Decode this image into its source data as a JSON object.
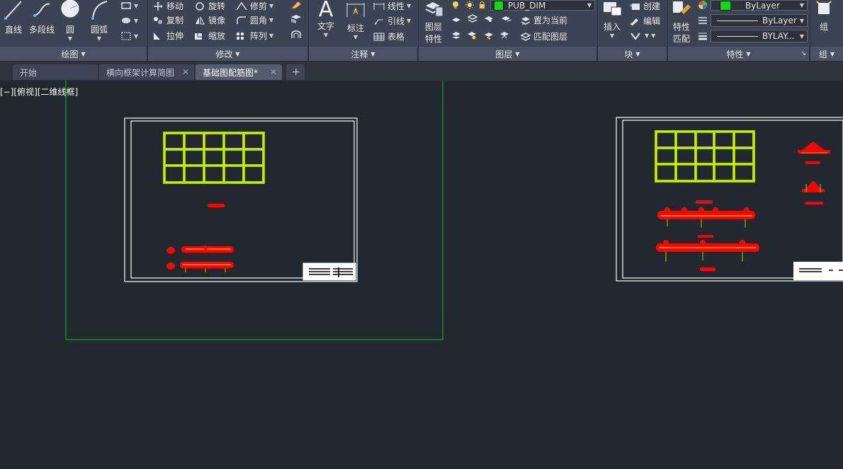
{
  "ribbon": {
    "draw_panel": {
      "title": "绘图",
      "tools": {
        "line": "直线",
        "polyline": "多段线",
        "circle": "圆",
        "arc": "圆弧"
      }
    },
    "modify_panel": {
      "title": "修改",
      "tools": {
        "move": "移动",
        "rotate": "旋转",
        "trim": "修剪",
        "copy": "复制",
        "mirror": "镜像",
        "fillet": "圆角",
        "stretch": "拉伸",
        "scale": "缩放",
        "array": "阵列"
      }
    },
    "annotation_panel": {
      "title": "注释",
      "tools": {
        "text": "文字",
        "dimension": "标注",
        "linetype": "线性",
        "leader": "引线",
        "table": "表格"
      }
    },
    "layers_panel": {
      "title": "图层",
      "tools": {
        "layer_properties_line1": "图层",
        "layer_properties_line2": "特性",
        "set_current": "置为当前",
        "match_layer": "匹配图层"
      },
      "current_layer": "PUB_DIM",
      "current_layer_color": "#00e000"
    },
    "block_panel": {
      "title": "块",
      "tools": {
        "insert": "插入",
        "create": "创建",
        "edit": "编辑"
      }
    },
    "properties_panel": {
      "title": "特性",
      "tools": {
        "match_line1": "特性",
        "match_line2": "匹配"
      },
      "color_value": "ByLayer",
      "color_swatch": "#00e000",
      "linetype_value": "ByLayer",
      "lineweight_value": "BYLAY..."
    },
    "group_panel": {
      "title": "组",
      "tools": {
        "group": "组"
      }
    }
  },
  "file_tabs": {
    "tabs": [
      {
        "label": "开始",
        "active": false,
        "closable": false
      },
      {
        "label": "横向框架计算简图",
        "active": false,
        "closable": true
      },
      {
        "label": "基础图配筋图*",
        "active": true,
        "closable": true
      }
    ],
    "close_glyph": "✕",
    "new_tab_glyph": "+"
  },
  "viewport": {
    "controls_label": "[−][俯视][二维线框]",
    "background": "#212830"
  },
  "drawing_colors": {
    "rebar": "#9bd400",
    "rebar_core": "#ffff00",
    "dimension_red": "#ff0000",
    "viewport_frame": "#00cc00"
  }
}
